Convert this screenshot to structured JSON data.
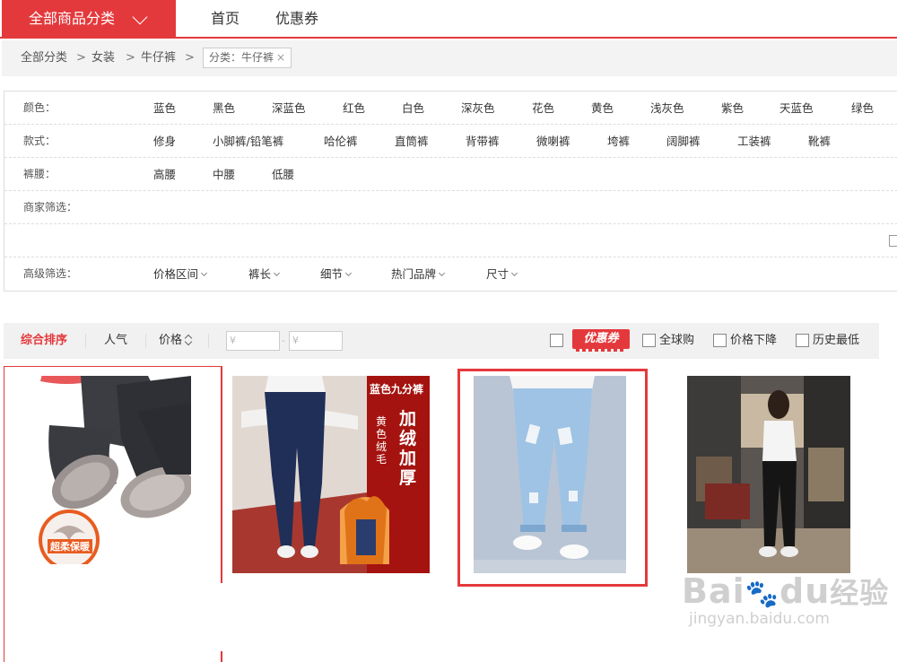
{
  "topnav": {
    "category_button": "全部商品分类",
    "links": [
      "首页",
      "优惠券"
    ]
  },
  "breadcrumb": {
    "items": [
      "全部分类",
      "女装",
      "牛仔裤"
    ],
    "separator": ">",
    "tag": "分类：牛仔裤",
    "tag_close": "×"
  },
  "filters": {
    "color": {
      "label": "颜色：",
      "options": [
        "蓝色",
        "黑色",
        "深蓝色",
        "红色",
        "白色",
        "深灰色",
        "花色",
        "黄色",
        "浅灰色",
        "紫色",
        "天蓝色",
        "绿色"
      ]
    },
    "style": {
      "label": "款式：",
      "options": [
        "修身",
        "小脚裤/铅笔裤",
        "哈伦裤",
        "直筒裤",
        "背带裤",
        "微喇裤",
        "垮裤",
        "阔脚裤",
        "工装裤",
        "靴裤"
      ]
    },
    "waist": {
      "label": "裤腰：",
      "options": [
        "高腰",
        "中腰",
        "低腰"
      ]
    },
    "merchant": {
      "label": "商家筛选："
    },
    "advanced": {
      "label": "高级筛选：",
      "options": [
        "价格区间",
        "裤长",
        "细节",
        "热门品牌",
        "尺寸"
      ]
    }
  },
  "sortbar": {
    "sorts": [
      "综合排序",
      "人气",
      "价格"
    ],
    "price_min_placeholder": "¥",
    "price_max_placeholder": "¥",
    "price_dash": "-",
    "coupon_badge": "优惠券",
    "checks": [
      "全球购",
      "价格下降",
      "历史最低"
    ]
  },
  "products": {
    "p1_badge": "超柔保暖",
    "p2_tag_title": "蓝色九分裤",
    "p2_tag_sub": "黄色绒毛",
    "p2_tag_big": "加绒加厚"
  },
  "watermark": {
    "brand": "Bai",
    "brand2": "du",
    "brand_cn": "经验",
    "url": "jingyan.baidu.com"
  },
  "colors": {
    "accent": "#e4393c"
  }
}
